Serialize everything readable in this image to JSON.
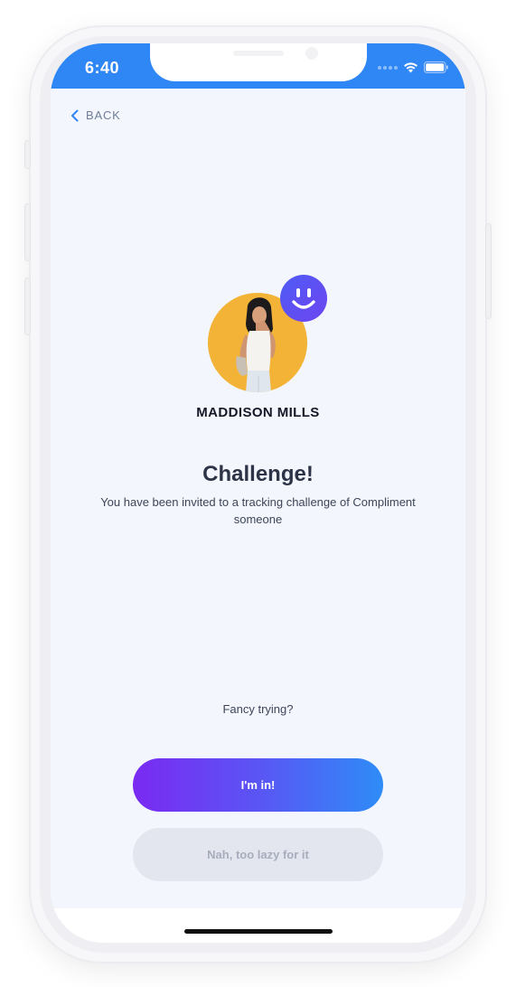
{
  "status_bar": {
    "time": "6:40"
  },
  "nav": {
    "back_label": "BACK"
  },
  "profile": {
    "name": "MADDISON MILLS"
  },
  "challenge": {
    "title": "Challenge!",
    "description": "You have been invited to a tracking challenge of Compliment someone"
  },
  "prompt": {
    "text": "Fancy trying?"
  },
  "actions": {
    "accept_label": "I'm in!",
    "decline_label": "Nah, too lazy for it"
  },
  "colors": {
    "status_bar": "#2f86f5",
    "accent_start": "#7a2af2",
    "accent_end": "#2e8cf7",
    "avatar_bg": "#f2b336",
    "screen_bg": "#f3f6fd"
  },
  "icons": {
    "back": "chevron-left-icon",
    "badge": "smiley-face-icon",
    "wifi": "wifi-icon",
    "battery": "battery-icon"
  }
}
